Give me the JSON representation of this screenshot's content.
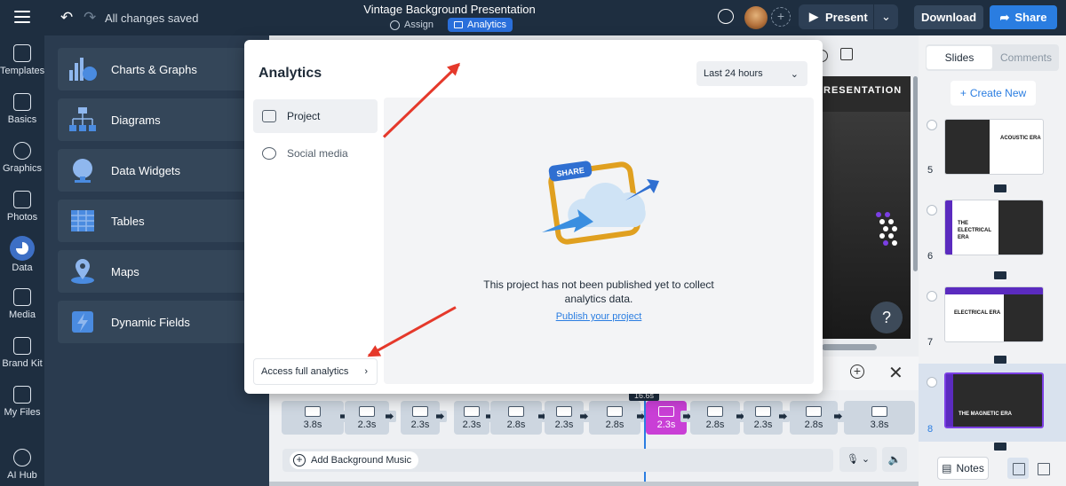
{
  "topbar": {
    "status": "All changes saved",
    "title": "Vintage Background Presentation",
    "assign_label": "Assign",
    "analytics_label": "Analytics",
    "present_label": "Present",
    "download_label": "Download",
    "share_label": "Share",
    "accent_color": "#2a7de1"
  },
  "rail": {
    "items": [
      {
        "label": "Templates"
      },
      {
        "label": "Basics"
      },
      {
        "label": "Graphics"
      },
      {
        "label": "Photos"
      },
      {
        "label": "Data",
        "active": true
      },
      {
        "label": "Media"
      },
      {
        "label": "Brand Kit"
      },
      {
        "label": "My Files"
      },
      {
        "label": "AI Hub"
      }
    ]
  },
  "panel": {
    "categories": [
      {
        "label": "Charts & Graphs",
        "icon": "bar-chart-icon"
      },
      {
        "label": "Diagrams",
        "icon": "org-chart-icon"
      },
      {
        "label": "Data Widgets",
        "icon": "gauge-icon"
      },
      {
        "label": "Tables",
        "icon": "table-icon"
      },
      {
        "label": "Maps",
        "icon": "map-pin-icon"
      },
      {
        "label": "Dynamic Fields",
        "icon": "lightning-icon"
      }
    ]
  },
  "canvas": {
    "slide_title": "RESENTATION",
    "help_label": "?"
  },
  "timeline": {
    "playhead_label": "16.6s",
    "clips": [
      "3.8s",
      "2.3s",
      "2.3s",
      "2.3s",
      "2.8s",
      "2.3s",
      "2.8s",
      "2.3s",
      "2.8s",
      "2.3s",
      "2.8s",
      "3.8s"
    ],
    "active_clip_index": 7,
    "active_color": "#c93fd6",
    "add_music_label": "Add Background Music"
  },
  "right_panel": {
    "tabs": [
      "Slides",
      "Comments"
    ],
    "create_label": "Create New",
    "slides": [
      {
        "number": "5",
        "title": "ACOUSTIC ERA"
      },
      {
        "number": "6",
        "title": "THE ELECTRICAL ERA"
      },
      {
        "number": "7",
        "title": "ELECTRICAL ERA"
      },
      {
        "number": "8",
        "title": "THE MAGNETIC ERA",
        "selected": true
      }
    ],
    "notes_label": "Notes"
  },
  "modal": {
    "title": "Analytics",
    "period_selected": "Last 24 hours",
    "nav": [
      {
        "label": "Project",
        "active": true
      },
      {
        "label": "Social media"
      }
    ],
    "illustration_label": "SHARE",
    "message": "This project has not been published yet to collect analytics data.",
    "publish_link": "Publish your project",
    "full_analytics_label": "Access full analytics",
    "annotation_color": "#e5392b"
  }
}
